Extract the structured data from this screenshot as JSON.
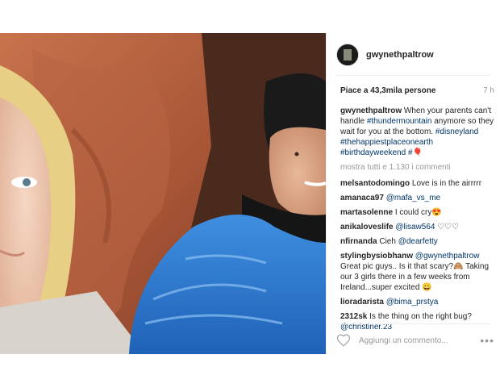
{
  "header": {
    "username": "gwynethpaltrow"
  },
  "post": {
    "likes": "Piace a 43,3mila persone",
    "time": "7 h",
    "caption_user": "gwynethpaltrow",
    "caption_text": "When your parents can't handle",
    "caption_tag1": "#thundermountain",
    "caption_text2": "anymore so they wait for you at the bottom.",
    "caption_tags": "#disneyland #thehappiestplaceonearth #birthdayweekend",
    "caption_tail": "#",
    "caption_emoji": "🎈",
    "view_all": "mostra tutti e 1.130 i commenti"
  },
  "comments": [
    {
      "user": "melsantodomingo",
      "text": "Love is in the airrrrr",
      "tag": ""
    },
    {
      "user": "amanaca97",
      "text": "",
      "tag": "@mafa_vs_me"
    },
    {
      "user": "martasolenne",
      "text": "I could cry😍",
      "tag": ""
    },
    {
      "user": "anikaloveslife",
      "text": "♡♡♡",
      "tag": "@lisaw564"
    },
    {
      "user": "nfirnanda",
      "text": "Cieh",
      "tag": "@dearfetty"
    },
    {
      "user": "stylingbysiobhanw",
      "text": "Great pic guys.. Is it that scary?🙈 Taking our 3 girls there in a few weeks from Ireland...super excited 😀",
      "tag": "@gwynethpaltrow"
    },
    {
      "user": "lioradarista",
      "text": "",
      "tag": "@bima_prstya"
    },
    {
      "user": "2312sk",
      "text": "Is the thing on the right bug?",
      "tag": "@christiner.23"
    }
  ],
  "add_comment": {
    "placeholder": "Aggiungi un commento..."
  },
  "icons": {
    "like": "heart-icon",
    "options": "more-options-icon"
  },
  "colors": {
    "tag_link": "#003569",
    "muted": "#999999"
  }
}
